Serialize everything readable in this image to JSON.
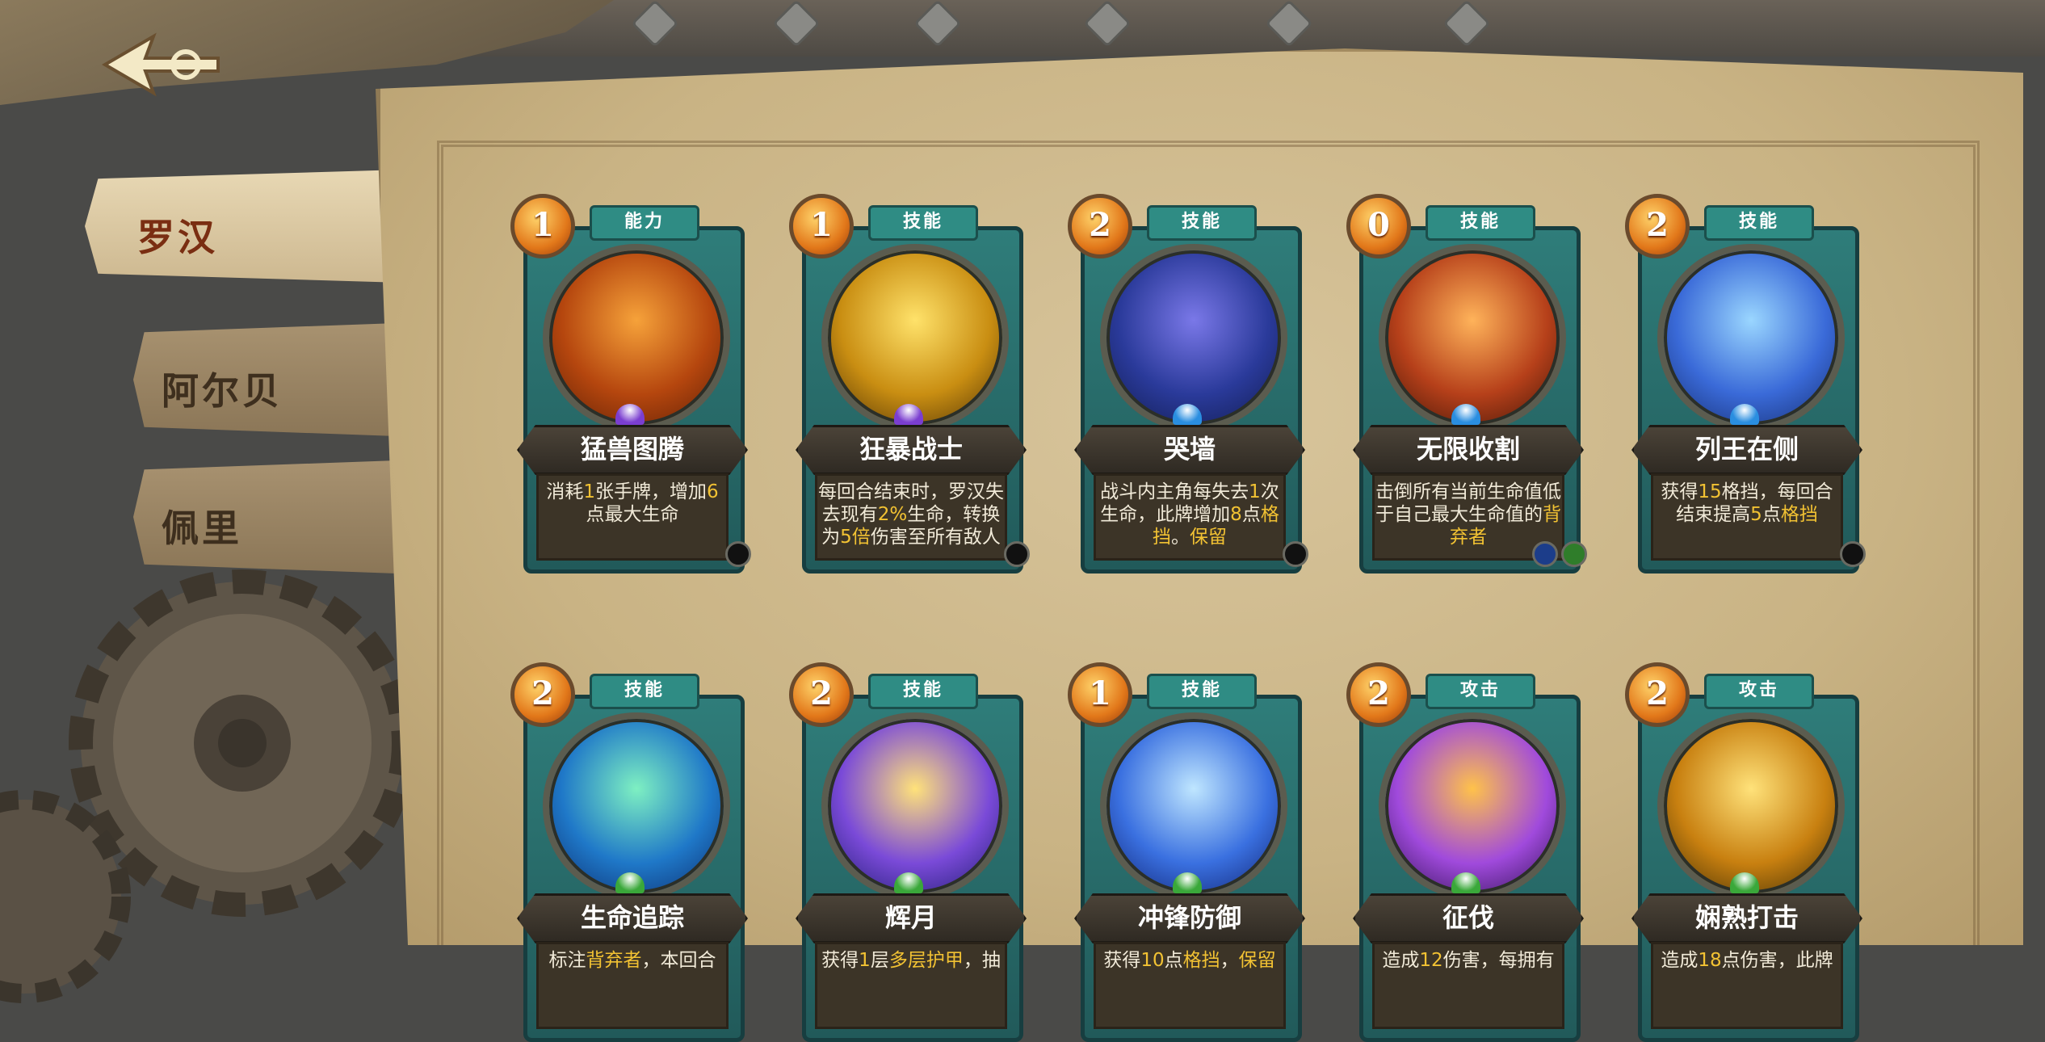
{
  "tabs": [
    {
      "label": "罗汉",
      "active": true
    },
    {
      "label": "阿尔贝",
      "active": false
    },
    {
      "label": "佩里",
      "active": false
    }
  ],
  "cards": [
    {
      "cost": "1",
      "type": "能力",
      "name": "猛兽图腾",
      "gem_color": "#7b3ed0",
      "desc_parts": [
        "消耗",
        "1",
        "张手牌，增加",
        "6",
        "点最大生命"
      ],
      "art_colors": [
        "#f6a23a",
        "#b5460e",
        "#5a1e05"
      ],
      "dots": [
        "#111111"
      ]
    },
    {
      "cost": "1",
      "type": "技能",
      "name": "狂暴战士",
      "gem_color": "#7b3ed0",
      "desc_parts": [
        "每回合结束时，罗汉失去现有",
        "2%",
        "生命，转换为",
        "5倍",
        "伤害至所有敌人"
      ],
      "art_colors": [
        "#ffe26a",
        "#c98e12",
        "#4a2e05"
      ],
      "dots": [
        "#111111"
      ]
    },
    {
      "cost": "2",
      "type": "技能",
      "name": "哭墙",
      "gem_color": "#2a8ee0",
      "desc_parts": [
        "战斗内主角每失去",
        "1",
        "次生命，此牌增加",
        "8",
        "点",
        "格挡",
        "。",
        "保留"
      ],
      "art_colors": [
        "#7a78e8",
        "#2a3a9a",
        "#101a4a"
      ],
      "dots": [
        "#111111"
      ]
    },
    {
      "cost": "0",
      "type": "技能",
      "name": "无限收割",
      "gem_color": "#2a8ee0",
      "desc_parts": [
        "击倒所有当前生命值低于自己最大生命值的",
        "背弃者"
      ],
      "art_colors": [
        "#ffb35a",
        "#b6401a",
        "#3a1206"
      ],
      "dots": [
        "#1c3d8a",
        "#2f7d2a"
      ]
    },
    {
      "cost": "2",
      "type": "技能",
      "name": "列王在侧",
      "gem_color": "#2a8ee0",
      "desc_parts": [
        "获得",
        "15",
        "格挡，每回合结束提高",
        "5",
        "点",
        "格挡"
      ],
      "art_colors": [
        "#9ad6ff",
        "#3a6ad8",
        "#142a6a"
      ],
      "dots": [
        "#111111"
      ]
    },
    {
      "cost": "2",
      "type": "技能",
      "name": "生命追踪",
      "gem_color": "#3aa83a",
      "desc_parts": [
        "标注",
        "背弃者",
        "，本回合"
      ],
      "art_colors": [
        "#7ef0c2",
        "#1f78c8",
        "#0c2a6a"
      ],
      "dots": []
    },
    {
      "cost": "2",
      "type": "技能",
      "name": "辉月",
      "gem_color": "#3aa83a",
      "desc_parts": [
        "获得",
        "1",
        "层",
        "多层护甲",
        "，抽"
      ],
      "art_colors": [
        "#ffe27a",
        "#7a4ad8",
        "#1a1a6a"
      ],
      "dots": []
    },
    {
      "cost": "1",
      "type": "技能",
      "name": "冲锋防御",
      "gem_color": "#3aa83a",
      "desc_parts": [
        "获得",
        "10",
        "点",
        "格挡",
        "，",
        "保留"
      ],
      "art_colors": [
        "#bfe6ff",
        "#3a70e0",
        "#0e1e6a"
      ],
      "dots": []
    },
    {
      "cost": "2",
      "type": "攻击",
      "name": "征伐",
      "gem_color": "#3aa83a",
      "desc_parts": [
        "造成",
        "12",
        "伤害，每拥有"
      ],
      "art_colors": [
        "#ffc24a",
        "#a04adc",
        "#2a0e4a"
      ],
      "dots": []
    },
    {
      "cost": "2",
      "type": "攻击",
      "name": "娴熟打击",
      "gem_color": "#3aa83a",
      "desc_parts": [
        "造成",
        "18",
        "点伤害，此牌"
      ],
      "art_colors": [
        "#ffe27a",
        "#c88010",
        "#3a2a05"
      ],
      "dots": []
    }
  ]
}
